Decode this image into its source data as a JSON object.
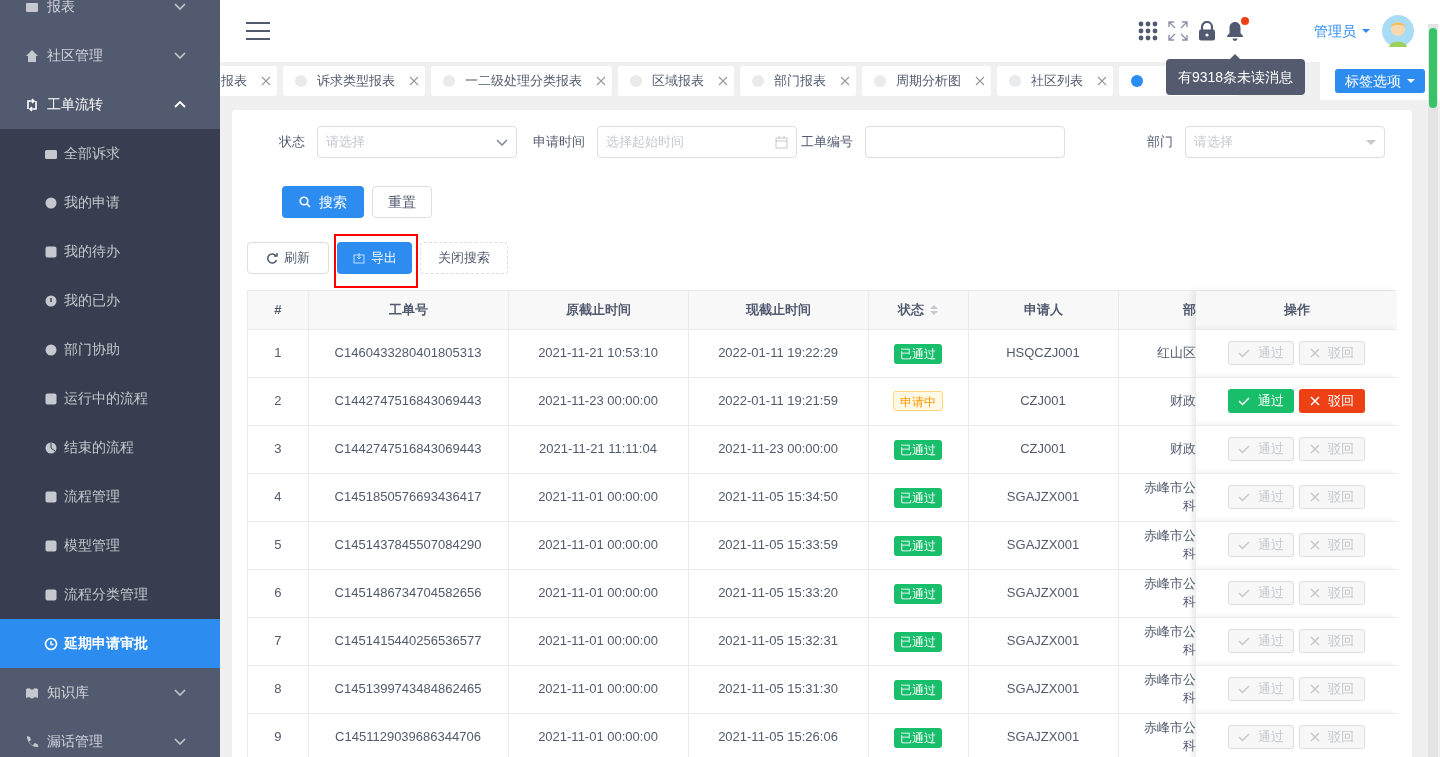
{
  "sidebar": {
    "items": [
      {
        "label": "报表",
        "expanded": false
      },
      {
        "label": "社区管理",
        "expanded": false
      },
      {
        "label": "工单流转",
        "expanded": true,
        "children": [
          {
            "label": "全部诉求",
            "selected": false
          },
          {
            "label": "我的申请",
            "selected": false
          },
          {
            "label": "我的待办",
            "selected": false
          },
          {
            "label": "我的已办",
            "selected": false
          },
          {
            "label": "部门协助",
            "selected": false
          },
          {
            "label": "运行中的流程",
            "selected": false
          },
          {
            "label": "结束的流程",
            "selected": false
          },
          {
            "label": "流程管理",
            "selected": false
          },
          {
            "label": "模型管理",
            "selected": false
          },
          {
            "label": "流程分类管理",
            "selected": false
          },
          {
            "label": "延期申请审批",
            "selected": true
          }
        ]
      },
      {
        "label": "知识库",
        "expanded": false
      },
      {
        "label": "漏话管理",
        "expanded": false
      }
    ]
  },
  "header": {
    "user": "管理员",
    "notification_tooltip": "有9318条未读消息",
    "has_unread": true
  },
  "tabs": [
    {
      "label": "报表",
      "selected": false
    },
    {
      "label": "诉求类型报表",
      "selected": false
    },
    {
      "label": "一二级处理分类报表",
      "selected": false
    },
    {
      "label": "区域报表",
      "selected": false
    },
    {
      "label": "部门报表",
      "selected": false
    },
    {
      "label": "周期分析图",
      "selected": false
    },
    {
      "label": "社区列表",
      "selected": false
    },
    {
      "selected": true
    }
  ],
  "tab_options": "标签选项",
  "filters": [
    {
      "label": "状态",
      "kind": "select",
      "placeholder": "请选择"
    },
    {
      "label": "申请时间",
      "kind": "date",
      "placeholder": "选择起始时间"
    },
    {
      "label": "工单编号",
      "kind": "text"
    },
    {
      "label": "部门",
      "kind": "tree",
      "placeholder": "请选择"
    }
  ],
  "search_buttons": [
    {
      "label": "搜索",
      "kind": "primary"
    },
    {
      "label": "重置",
      "kind": "default"
    }
  ],
  "toolbar": [
    {
      "label": "刷新",
      "kind": "refresh",
      "highlighted": false
    },
    {
      "label": "导出",
      "kind": "export",
      "highlighted": true
    },
    {
      "label": "关闭搜索",
      "kind": "dashed",
      "highlighted": false
    }
  ],
  "table": {
    "columns": [
      "#",
      "工单号",
      "原截止时间",
      "现截止时间",
      "状态",
      "申请人",
      "部",
      "操作"
    ],
    "rows": [
      {
        "index": "1",
        "order_no": "C1460433280401805313",
        "old_deadline": "2021-11-21 10:53:10",
        "new_deadline": "2022-01-11 19:22:29",
        "status": {
          "text": "已通过",
          "kind": "success"
        },
        "applicant": "HSQCZJ001",
        "department": "红山区",
        "actions_disabled": true,
        "actions": [
          "通过",
          "驳回"
        ]
      },
      {
        "index": "2",
        "order_no": "C1442747516843069443",
        "old_deadline": "2021-11-23 00:00:00",
        "new_deadline": "2022-01-11 19:21:59",
        "status": {
          "text": "申请中",
          "kind": "pending"
        },
        "applicant": "CZJ001",
        "department": "财政",
        "actions_disabled": false,
        "actions": [
          "通过",
          "驳回"
        ]
      },
      {
        "index": "3",
        "order_no": "C1442747516843069443",
        "old_deadline": "2021-11-21 11:11:04",
        "new_deadline": "2021-11-23 00:00:00",
        "status": {
          "text": "已通过",
          "kind": "success"
        },
        "applicant": "CZJ001",
        "department": "财政",
        "actions_disabled": true,
        "actions": [
          "通过",
          "驳回"
        ]
      },
      {
        "index": "4",
        "order_no": "C1451850576693436417",
        "old_deadline": "2021-11-01 00:00:00",
        "new_deadline": "2021-11-05 15:34:50",
        "status": {
          "text": "已通过",
          "kind": "success"
        },
        "applicant": "SGAJZX001",
        "department": "赤峰市公科",
        "actions_disabled": true,
        "actions": [
          "通过",
          "驳回"
        ]
      },
      {
        "index": "5",
        "order_no": "C1451437845507084290",
        "old_deadline": "2021-11-01 00:00:00",
        "new_deadline": "2021-11-05 15:33:59",
        "status": {
          "text": "已通过",
          "kind": "success"
        },
        "applicant": "SGAJZX001",
        "department": "赤峰市公科",
        "actions_disabled": true,
        "actions": [
          "通过",
          "驳回"
        ]
      },
      {
        "index": "6",
        "order_no": "C1451486734704582656",
        "old_deadline": "2021-11-01 00:00:00",
        "new_deadline": "2021-11-05 15:33:20",
        "status": {
          "text": "已通过",
          "kind": "success"
        },
        "applicant": "SGAJZX001",
        "department": "赤峰市公科",
        "actions_disabled": true,
        "actions": [
          "通过",
          "驳回"
        ]
      },
      {
        "index": "7",
        "order_no": "C1451415440256536577",
        "old_deadline": "2021-11-01 00:00:00",
        "new_deadline": "2021-11-05 15:32:31",
        "status": {
          "text": "已通过",
          "kind": "success"
        },
        "applicant": "SGAJZX001",
        "department": "赤峰市公科",
        "actions_disabled": true,
        "actions": [
          "通过",
          "驳回"
        ]
      },
      {
        "index": "8",
        "order_no": "C1451399743484862465",
        "old_deadline": "2021-11-01 00:00:00",
        "new_deadline": "2021-11-05 15:31:30",
        "status": {
          "text": "已通过",
          "kind": "success"
        },
        "applicant": "SGAJZX001",
        "department": "赤峰市公科",
        "actions_disabled": true,
        "actions": [
          "通过",
          "驳回"
        ]
      },
      {
        "index": "9",
        "order_no": "C1451129039686344706",
        "old_deadline": "2021-11-01 00:00:00",
        "new_deadline": "2021-11-05 15:26:06",
        "status": {
          "text": "已通过",
          "kind": "success"
        },
        "applicant": "SGAJZX001",
        "department": "赤峰市公科",
        "actions_disabled": true,
        "actions": [
          "通过",
          "驳回"
        ]
      }
    ]
  }
}
